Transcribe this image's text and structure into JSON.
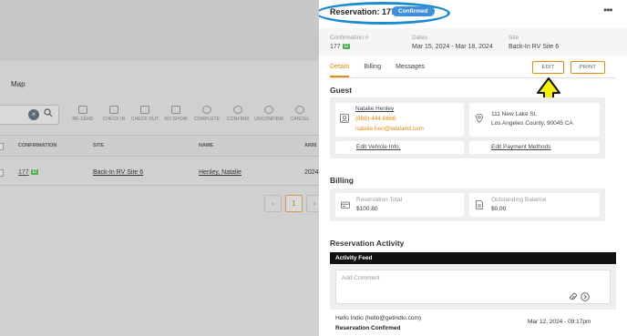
{
  "background": {
    "map_label": "Map",
    "actions": [
      "RE-SEND",
      "CHECK IN",
      "CHECK OUT",
      "NO SHOW",
      "COMPLETE",
      "CONFIRM",
      "UNCONFIRM",
      "CANCEL"
    ],
    "columns": [
      "CONFIRMATION",
      "SITE",
      "NAME",
      "ARRI"
    ],
    "row": {
      "confirmation": "177",
      "confirmation_badge": "D",
      "site": "Back-In RV Site 6",
      "name": "Henley, Natalie",
      "arrival": "2024"
    },
    "pager": {
      "current": "1"
    }
  },
  "panel": {
    "title": "Reservation: 177",
    "status": "Confirmed",
    "meta": {
      "confirmation_label": "Confirmation #",
      "confirmation_value": "177",
      "confirmation_badge": "D",
      "dates_label": "Dates",
      "dates_value": "Mar 15, 2024 - Mar 18, 2024",
      "site_label": "Site",
      "site_value": "Back-In RV Site 6"
    },
    "tabs": [
      "Details",
      "Billing",
      "Messages"
    ],
    "edit_label": "EDIT",
    "print_label": "PRINT",
    "guest": {
      "heading": "Guest",
      "name": "Natalie Henley",
      "phone": "(888) 444-6666",
      "email": "natalie.hen@lalaland.com",
      "address_line1": "111 New Lake St.",
      "address_line2": "Los Angeles County, 90045 CA",
      "edit_vehicle": "Edit Vehicle Info.",
      "edit_payment": "Edit Payment Methods"
    },
    "billing": {
      "heading": "Billing",
      "total_label": "Reservation Total",
      "total_value": "$100.80",
      "balance_label": "Outstanding Balance",
      "balance_value": "$0.00"
    },
    "activity": {
      "heading": "Reservation Activity",
      "feed_title": "Activity Feed",
      "comment_placeholder": "Add Comment",
      "entry_author": "Hello Indio (hello@getindio.com)",
      "entry_text": "Reservation Confirmed",
      "entry_date": "Mar 12, 2024 - 09:17pm"
    }
  },
  "colors": {
    "accent": "#e8890c",
    "status_blue": "#3d8fdd",
    "highlight_ring": "#1a8bd1",
    "arrow_yellow": "#f5f200"
  }
}
